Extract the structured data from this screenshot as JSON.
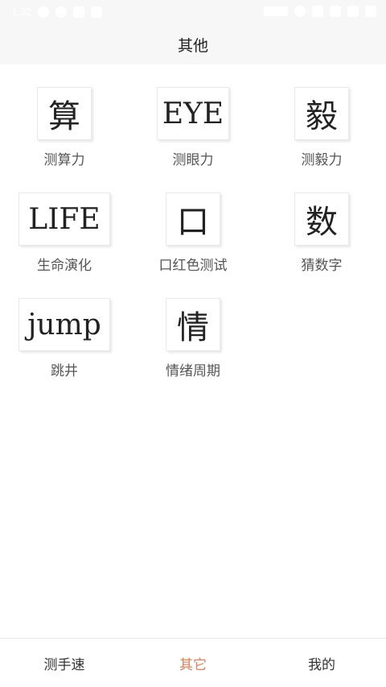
{
  "status": {
    "time": "1:32"
  },
  "header": {
    "title": "其他"
  },
  "grid": [
    {
      "glyph": "算",
      "label": "测算力"
    },
    {
      "glyph": "EYE",
      "label": "测眼力"
    },
    {
      "glyph": "毅",
      "label": "测毅力"
    },
    {
      "glyph": "LIFE",
      "label": "生命演化"
    },
    {
      "glyph": "口",
      "label": "口红色测试"
    },
    {
      "glyph": "数",
      "label": "猜数字"
    },
    {
      "glyph": "jump",
      "label": "跳井"
    },
    {
      "glyph": "情",
      "label": "情绪周期"
    }
  ],
  "nav": {
    "tabs": [
      "测手速",
      "其它",
      "我的"
    ],
    "active_index": 1,
    "active_color": "#d9825b"
  }
}
